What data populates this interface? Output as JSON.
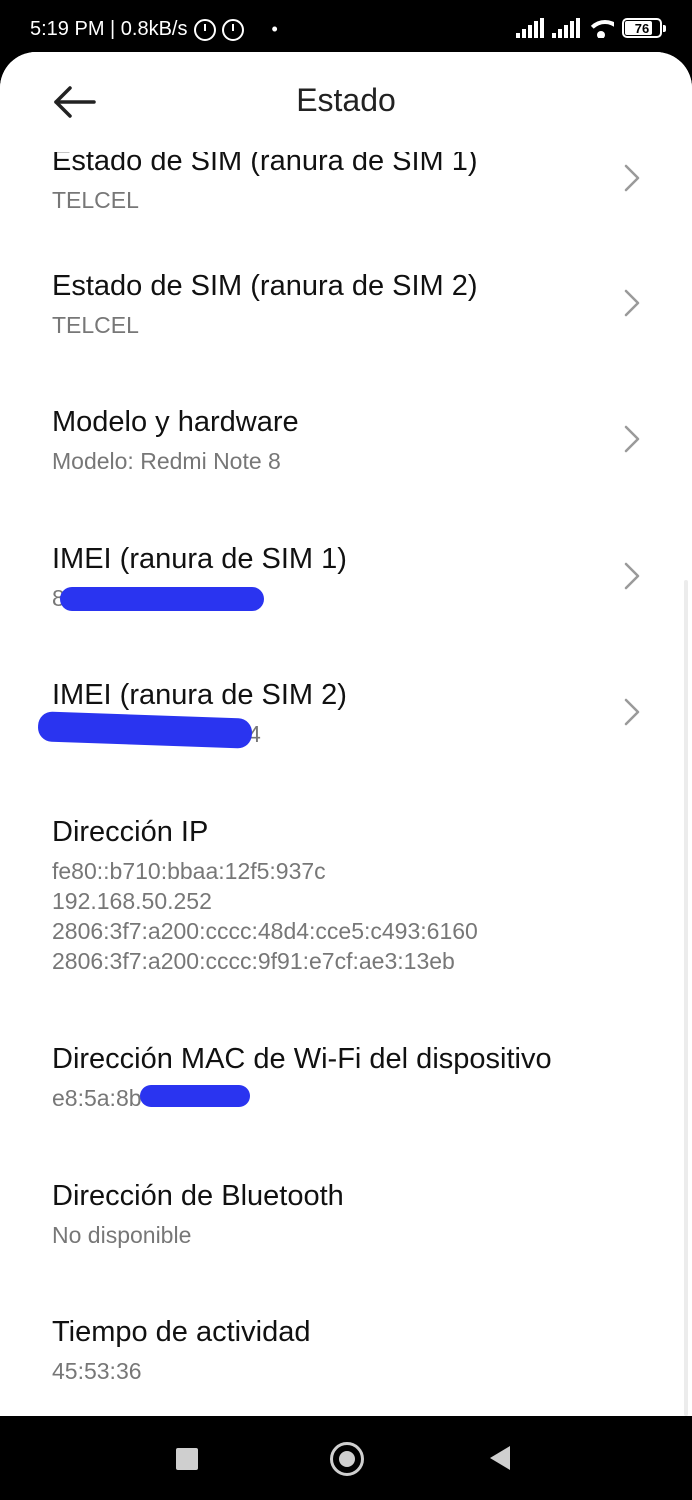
{
  "status_bar": {
    "time_speed": "5:19 PM | 0.8kB/s",
    "dot": "•",
    "battery_level": "76",
    "icons": [
      "settings-sync-icon",
      "alarm-icon",
      "signal-icon",
      "signal-icon",
      "wifi-icon",
      "battery-icon"
    ]
  },
  "header": {
    "title": "Estado",
    "back_icon": "arrow-left-icon"
  },
  "items": [
    {
      "title": "Estado de SIM (ranura de SIM 1)",
      "subtitle": "TELCEL",
      "chevron": true
    },
    {
      "title": "Estado de SIM (ranura de SIM 2)",
      "subtitle": "TELCEL",
      "chevron": true
    },
    {
      "title": "Modelo y hardware",
      "subtitle": "Modelo: Redmi Note 8",
      "chevron": true
    },
    {
      "title": "IMEI (ranura de SIM 1)",
      "subtitle": "8",
      "chevron": true
    },
    {
      "title": "IMEI (ranura de SIM 2)",
      "subtitle": "4",
      "chevron": true
    },
    {
      "title": "Dirección IP",
      "lines": [
        "fe80::b710:bbaa:12f5:937c",
        "192.168.50.252",
        "2806:3f7:a200:cccc:48d4:cce5:c493:6160",
        "2806:3f7:a200:cccc:9f91:e7cf:ae3:13eb"
      ],
      "chevron": false
    },
    {
      "title": "Dirección MAC de Wi-Fi del dispositivo",
      "subtitle": "e8:5a:8b",
      "chevron": false
    },
    {
      "title": "Dirección de Bluetooth",
      "subtitle": "No disponible",
      "chevron": false
    },
    {
      "title": "Tiempo de actividad",
      "subtitle": "45:53:36",
      "chevron": false
    }
  ],
  "colors": {
    "redaction": "#2a34f0",
    "title_text": "#111111",
    "subtitle_text": "#777777"
  },
  "nav_bar": {
    "icons": [
      "recents-square-icon",
      "home-circle-icon",
      "back-triangle-icon"
    ]
  }
}
